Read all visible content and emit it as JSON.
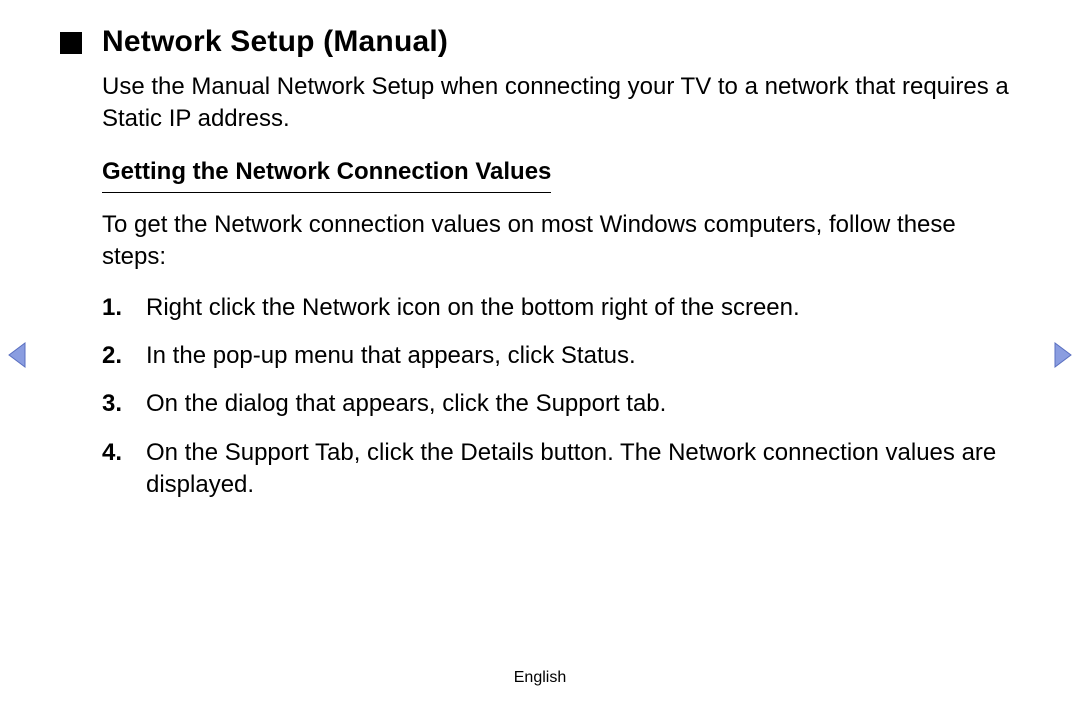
{
  "title": "Network Setup (Manual)",
  "intro": "Use the Manual Network Setup when connecting your TV to a network that requires a Static IP address.",
  "subhead": "Getting the Network Connection Values",
  "lead": "To get the Network connection values on most Windows computers, follow these steps:",
  "steps": [
    {
      "num": "1.",
      "text": "Right click the Network icon on the bottom right of the screen."
    },
    {
      "num": "2.",
      "text": "In the pop-up menu that appears, click Status."
    },
    {
      "num": "3.",
      "text": "On the dialog that appears, click the Support tab."
    },
    {
      "num": "4.",
      "text": "On the Support Tab, click the Details button. The Network connection values are displayed."
    }
  ],
  "footer_language": "English",
  "colors": {
    "arrow_fill": "#8a9de0",
    "arrow_stroke": "#5a6fc0"
  }
}
